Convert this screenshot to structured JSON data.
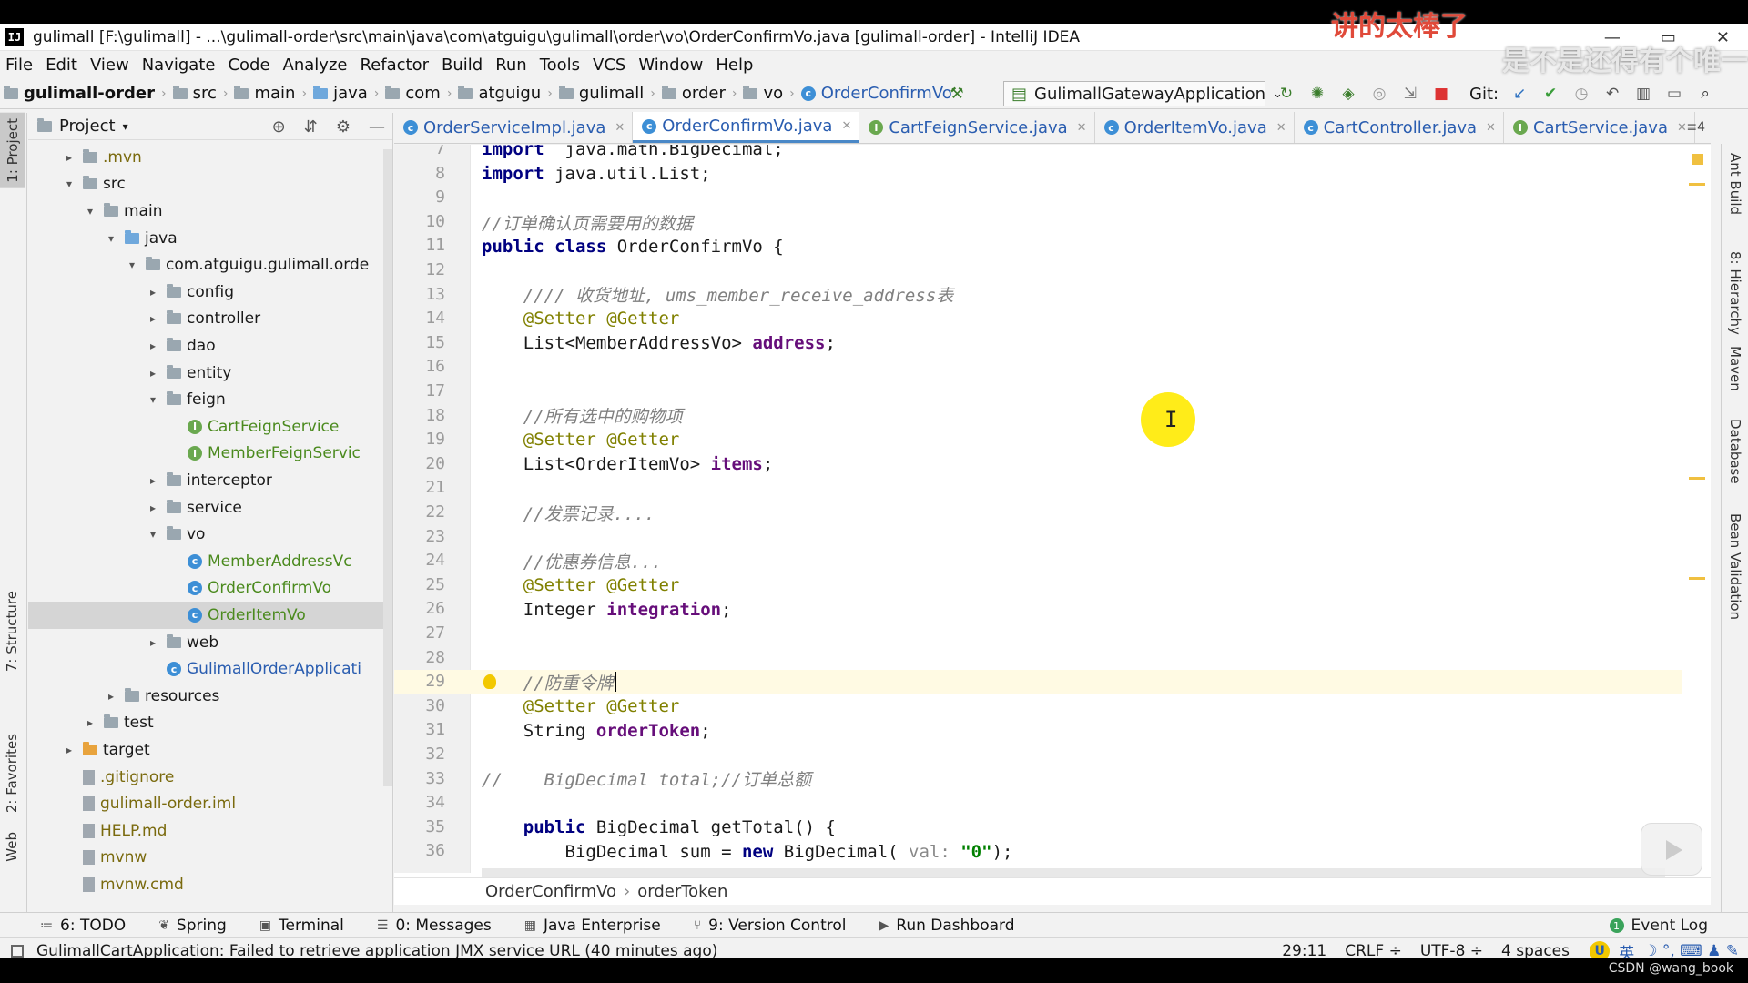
{
  "window": {
    "title": "gulimall [F:\\gulimall] - ...\\gulimall-order\\src\\main\\java\\com\\atguigu\\gulimall\\order\\vo\\OrderConfirmVo.java [gulimall-order] - IntelliJ IDEA",
    "app_icon": "IJ",
    "controls": [
      "—",
      "▭",
      "✕"
    ]
  },
  "menu": [
    "File",
    "Edit",
    "View",
    "Navigate",
    "Code",
    "Analyze",
    "Refactor",
    "Build",
    "Run",
    "Tools",
    "VCS",
    "Window",
    "Help"
  ],
  "navbar": {
    "crumbs": [
      "gulimall-order",
      "src",
      "main",
      "java",
      "com",
      "atguigu",
      "gulimall",
      "order",
      "vo",
      "OrderConfirmVo"
    ],
    "run_config": "GulimallGatewayApplication",
    "git_label": "Git:"
  },
  "left_tabs": [
    "1: Project",
    "7: Structure",
    "2: Favorites",
    "Web"
  ],
  "right_tabs": [
    "Ant Build",
    "8: Hierarchy",
    "Maven",
    "Database",
    "Bean Validation"
  ],
  "project": {
    "header": "Project",
    "tree": [
      {
        "label": ".mvn",
        "depth": 1,
        "arrow": "›",
        "icon": "folder",
        "color": "olive"
      },
      {
        "label": "src",
        "depth": 1,
        "arrow": "⌄",
        "icon": "folder",
        "color": ""
      },
      {
        "label": "main",
        "depth": 2,
        "arrow": "⌄",
        "icon": "folder",
        "color": ""
      },
      {
        "label": "java",
        "depth": 3,
        "arrow": "⌄",
        "icon": "folder-blue",
        "color": ""
      },
      {
        "label": "com.atguigu.gulimall.orde",
        "depth": 4,
        "arrow": "⌄",
        "icon": "folder",
        "color": ""
      },
      {
        "label": "config",
        "depth": 5,
        "arrow": "›",
        "icon": "folder",
        "color": ""
      },
      {
        "label": "controller",
        "depth": 5,
        "arrow": "›",
        "icon": "folder",
        "color": ""
      },
      {
        "label": "dao",
        "depth": 5,
        "arrow": "›",
        "icon": "folder",
        "color": ""
      },
      {
        "label": "entity",
        "depth": 5,
        "arrow": "›",
        "icon": "folder",
        "color": ""
      },
      {
        "label": "feign",
        "depth": 5,
        "arrow": "⌄",
        "icon": "folder",
        "color": ""
      },
      {
        "label": "CartFeignService",
        "depth": 6,
        "arrow": "",
        "icon": "interface",
        "color": "green"
      },
      {
        "label": "MemberFeignServic",
        "depth": 6,
        "arrow": "",
        "icon": "interface",
        "color": "green"
      },
      {
        "label": "interceptor",
        "depth": 5,
        "arrow": "›",
        "icon": "folder",
        "color": ""
      },
      {
        "label": "service",
        "depth": 5,
        "arrow": "›",
        "icon": "folder",
        "color": ""
      },
      {
        "label": "vo",
        "depth": 5,
        "arrow": "⌄",
        "icon": "folder",
        "color": ""
      },
      {
        "label": "MemberAddressVc",
        "depth": 6,
        "arrow": "",
        "icon": "class",
        "color": "green"
      },
      {
        "label": "OrderConfirmVo",
        "depth": 6,
        "arrow": "",
        "icon": "class",
        "color": "green"
      },
      {
        "label": "OrderItemVo",
        "depth": 6,
        "arrow": "",
        "icon": "class",
        "color": "green",
        "selected": true
      },
      {
        "label": "web",
        "depth": 5,
        "arrow": "›",
        "icon": "folder",
        "color": ""
      },
      {
        "label": "GulimallOrderApplicati",
        "depth": 5,
        "arrow": "",
        "icon": "class",
        "color": "blue"
      },
      {
        "label": "resources",
        "depth": 3,
        "arrow": "›",
        "icon": "folder",
        "color": ""
      },
      {
        "label": "test",
        "depth": 2,
        "arrow": "›",
        "icon": "folder",
        "color": ""
      },
      {
        "label": "target",
        "depth": 1,
        "arrow": "›",
        "icon": "folder-orange",
        "color": ""
      },
      {
        "label": ".gitignore",
        "depth": 1,
        "arrow": "",
        "icon": "file",
        "color": "olive"
      },
      {
        "label": "gulimall-order.iml",
        "depth": 1,
        "arrow": "",
        "icon": "file",
        "color": "olive"
      },
      {
        "label": "HELP.md",
        "depth": 1,
        "arrow": "",
        "icon": "file",
        "color": "olive"
      },
      {
        "label": "mvnw",
        "depth": 1,
        "arrow": "",
        "icon": "file",
        "color": "olive"
      },
      {
        "label": "mvnw.cmd",
        "depth": 1,
        "arrow": "",
        "icon": "file",
        "color": "olive"
      }
    ]
  },
  "tabs": [
    {
      "name": "OrderServiceImpl.java",
      "icon": "class"
    },
    {
      "name": "OrderConfirmVo.java",
      "icon": "class",
      "active": true
    },
    {
      "name": "CartFeignService.java",
      "icon": "interface"
    },
    {
      "name": "OrderItemVo.java",
      "icon": "class"
    },
    {
      "name": "CartController.java",
      "icon": "class"
    },
    {
      "name": "CartService.java",
      "icon": "interface"
    }
  ],
  "tabs_more": "≡4",
  "code_lines": [
    {
      "n": "7",
      "segs": [
        [
          "kw",
          "import"
        ],
        [
          "",
          "  java.math.BigDecimal;"
        ]
      ]
    },
    {
      "n": "8",
      "segs": [
        [
          "kw",
          "import"
        ],
        [
          "",
          " java.util.List;"
        ]
      ]
    },
    {
      "n": "9",
      "segs": []
    },
    {
      "n": "10",
      "segs": [
        [
          "cm",
          "//订单确认页需要用的数据"
        ]
      ]
    },
    {
      "n": "11",
      "segs": [
        [
          "kw",
          "public class"
        ],
        [
          "",
          " OrderConfirmVo {"
        ]
      ]
    },
    {
      "n": "12",
      "segs": []
    },
    {
      "n": "13",
      "segs": [
        [
          "",
          "    "
        ],
        [
          "cm",
          "//// 收货地址, ums_member_receive_address表"
        ]
      ]
    },
    {
      "n": "14",
      "segs": [
        [
          "",
          "    "
        ],
        [
          "an",
          "@Setter @Getter"
        ]
      ]
    },
    {
      "n": "15",
      "segs": [
        [
          "",
          "    List<MemberAddressVo> "
        ],
        [
          "fld",
          "address"
        ],
        [
          "",
          ";"
        ]
      ]
    },
    {
      "n": "16",
      "segs": []
    },
    {
      "n": "17",
      "segs": []
    },
    {
      "n": "18",
      "segs": [
        [
          "",
          "    "
        ],
        [
          "cm",
          "//所有选中的购物项"
        ]
      ]
    },
    {
      "n": "19",
      "segs": [
        [
          "",
          "    "
        ],
        [
          "an",
          "@Setter @Getter"
        ]
      ]
    },
    {
      "n": "20",
      "segs": [
        [
          "",
          "    List<OrderItemVo> "
        ],
        [
          "fld",
          "items"
        ],
        [
          "",
          ";"
        ]
      ]
    },
    {
      "n": "21",
      "segs": []
    },
    {
      "n": "22",
      "segs": [
        [
          "",
          "    "
        ],
        [
          "cm",
          "//发票记录...."
        ]
      ]
    },
    {
      "n": "23",
      "segs": []
    },
    {
      "n": "24",
      "segs": [
        [
          "",
          "    "
        ],
        [
          "cm",
          "//优惠券信息..."
        ]
      ]
    },
    {
      "n": "25",
      "segs": [
        [
          "",
          "    "
        ],
        [
          "an",
          "@Setter @Getter"
        ]
      ]
    },
    {
      "n": "26",
      "segs": [
        [
          "",
          "    Integer "
        ],
        [
          "fld",
          "integration"
        ],
        [
          "",
          ";"
        ]
      ]
    },
    {
      "n": "27",
      "segs": []
    },
    {
      "n": "28",
      "segs": []
    },
    {
      "n": "29",
      "segs": [
        [
          "",
          "    "
        ],
        [
          "cm",
          "//防重令牌"
        ]
      ],
      "current": true
    },
    {
      "n": "30",
      "segs": [
        [
          "",
          "    "
        ],
        [
          "an",
          "@Setter @Getter"
        ]
      ]
    },
    {
      "n": "31",
      "segs": [
        [
          "",
          "    String "
        ],
        [
          "fld",
          "orderToken"
        ],
        [
          "",
          ";"
        ]
      ]
    },
    {
      "n": "32",
      "segs": []
    },
    {
      "n": "33",
      "segs": [
        [
          "cm",
          "//    BigDecimal total;//订单总额"
        ]
      ]
    },
    {
      "n": "34",
      "segs": []
    },
    {
      "n": "35",
      "segs": [
        [
          "",
          "    "
        ],
        [
          "kw",
          "public"
        ],
        [
          "",
          " BigDecimal getTotal() {"
        ]
      ]
    },
    {
      "n": "36",
      "segs": [
        [
          "",
          "        BigDecimal sum = "
        ],
        [
          "kw",
          "new"
        ],
        [
          "",
          " BigDecimal( "
        ],
        [
          "hint",
          "val: "
        ],
        [
          "str",
          "\"0\""
        ],
        [
          "",
          ");"
        ]
      ]
    }
  ],
  "editor_breadcrumb": [
    "OrderConfirmVo",
    "orderToken"
  ],
  "bottom_tools": [
    {
      "label": "6: TODO",
      "icon": "≔"
    },
    {
      "label": "Spring",
      "icon": "❦"
    },
    {
      "label": "Terminal",
      "icon": "▣"
    },
    {
      "label": "0: Messages",
      "icon": "☰"
    },
    {
      "label": "Java Enterprise",
      "icon": "▦"
    },
    {
      "label": "9: Version Control",
      "icon": "⑂"
    },
    {
      "label": "Run Dashboard",
      "icon": "▶"
    }
  ],
  "event_log": "Event Log",
  "status": {
    "message": "GulimallCartApplication: Failed to retrieve application JMX service URL (40 minutes ago)",
    "position": "29:11",
    "line_sep": "CRLF ÷",
    "encoding": "UTF-8 ÷",
    "indent": "4 spaces"
  },
  "ime": {
    "u": "U",
    "lang": "英",
    "icons": "☽ °, ⌨ ♟ ✎"
  },
  "overlays": {
    "danmaku_red": "讲的太棒了",
    "danmaku_white": "是不是还得有个唯一",
    "watermark": "CSDN @wang_book"
  },
  "colors": {
    "keyword": "#000080",
    "comment": "#808080",
    "annotation": "#808000",
    "field": "#660e7a",
    "string": "#008000",
    "current_line": "#fffae3"
  }
}
